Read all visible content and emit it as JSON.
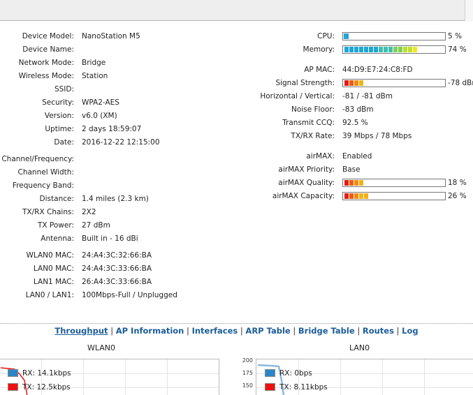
{
  "device": {
    "rows": [
      {
        "label": "Device Model:",
        "value": "NanoStation M5"
      },
      {
        "label": "Device Name:",
        "value": ""
      },
      {
        "label": "Network Mode:",
        "value": "Bridge"
      },
      {
        "label": "Wireless Mode:",
        "value": "Station"
      },
      {
        "label": "SSID:",
        "value": ""
      },
      {
        "label": "Security:",
        "value": "WPA2-AES"
      },
      {
        "label": "Version:",
        "value": "v6.0 (XM)"
      },
      {
        "label": "Uptime:",
        "value": "2 days 18:59:07"
      },
      {
        "label": "Date:",
        "value": "2016-12-22 12:15:00"
      },
      {
        "label": "Channel/Frequency:",
        "value": ""
      },
      {
        "label": "Channel Width:",
        "value": ""
      },
      {
        "label": "Frequency Band:",
        "value": ""
      },
      {
        "label": "Distance:",
        "value": "1.4 miles (2.3 km)"
      },
      {
        "label": "TX/RX Chains:",
        "value": "2X2"
      },
      {
        "label": "TX Power:",
        "value": "27 dBm"
      },
      {
        "label": "Antenna:",
        "value": "Built in - 16 dBi"
      },
      {
        "label": "WLAN0 MAC:",
        "value": "24:A4:3C:32:66:BA"
      },
      {
        "label": "LAN0 MAC:",
        "value": "24:A4:3C:33:66:BA"
      },
      {
        "label": "LAN1 MAC:",
        "value": "26:A4:3C:33:66:BA"
      },
      {
        "label": "LAN0 / LAN1:",
        "value": "100Mbps-Full / Unplugged"
      }
    ]
  },
  "status": {
    "cpu": {
      "label": "CPU:",
      "percent_text": "5 %",
      "fraction": 0.05
    },
    "memory": {
      "label": "Memory:",
      "percent_text": "74 %",
      "fraction": 0.74
    },
    "ap_mac": {
      "label": "AP MAC:",
      "value": "44:D9:E7:24:C8:FD"
    },
    "signal": {
      "label": "Signal Strength:",
      "value": "-78 dBm",
      "fraction": 0.2
    },
    "hv": {
      "label": "Horizontal / Vertical:",
      "value": "-81 / -81 dBm"
    },
    "noise": {
      "label": "Noise Floor:",
      "value": "-83 dBm"
    },
    "ccq": {
      "label": "Transmit CCQ:",
      "value": "92.5 %"
    },
    "rate": {
      "label": "TX/RX Rate:",
      "value": "39 Mbps / 78 Mbps"
    },
    "airmax": {
      "label": "airMAX:",
      "value": "Enabled"
    },
    "airmax_priority": {
      "label": "airMAX Priority:",
      "value": "Base"
    },
    "airmax_quality": {
      "label": "airMAX Quality:",
      "percent_text": "18 %",
      "fraction": 0.18
    },
    "airmax_capacity": {
      "label": "airMAX Capacity:",
      "percent_text": "26 %",
      "fraction": 0.26
    }
  },
  "tabs": {
    "throughput": "Throughput",
    "ap_information": "AP Information",
    "interfaces": "Interfaces",
    "arp_table": "ARP Table",
    "bridge_table": "Bridge Table",
    "routes": "Routes",
    "log": "Log",
    "separator": "|"
  },
  "graphs": {
    "wlan0": {
      "title": "WLAN0",
      "rx": "RX: 14.1kbps",
      "tx": "TX: 12.5kbps"
    },
    "lan0": {
      "title": "LAN0",
      "rx": "RX: 0bps",
      "tx": "TX: 8.11kbps",
      "yticks": [
        "200",
        "175",
        "150"
      ]
    }
  },
  "colors": {
    "accent_link": "#1c5d99",
    "bar_blue": "#1ea6d6",
    "rx_color": "#2a86c8",
    "tx_color": "#ee1111"
  }
}
